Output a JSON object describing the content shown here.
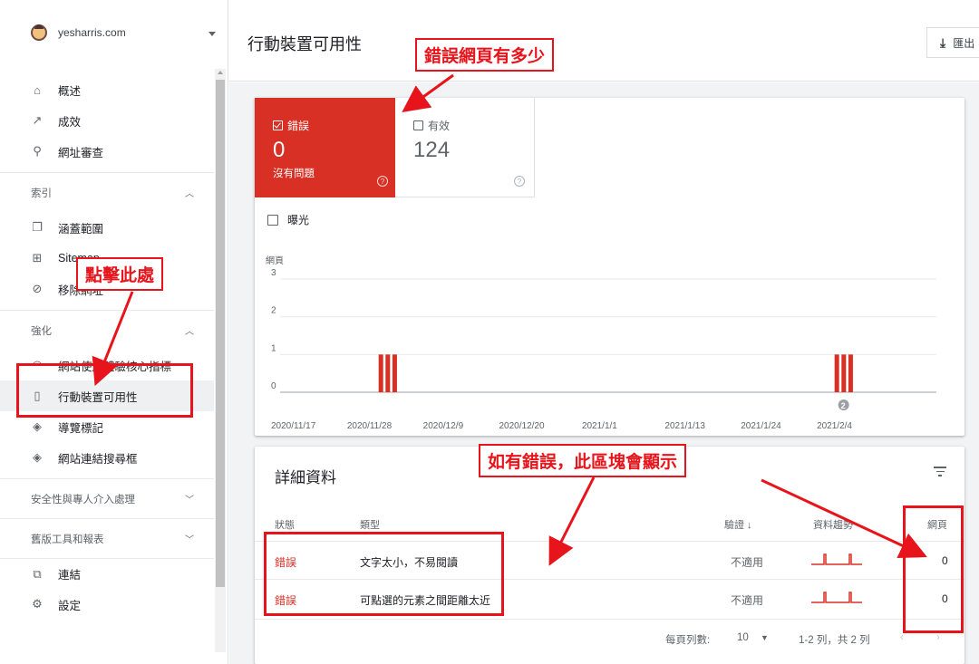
{
  "account": {
    "name": "yesharris.com"
  },
  "sidebar": {
    "top_items": [
      {
        "label": "概述",
        "icon": "home-icon"
      },
      {
        "label": "成效",
        "icon": "trending-icon"
      },
      {
        "label": "網址審查",
        "icon": "search-icon"
      }
    ],
    "index_section": {
      "title": "索引"
    },
    "index_items": [
      {
        "label": "涵蓋範圍",
        "icon": "copy-icon"
      },
      {
        "label": "Sitemap",
        "icon": "sitemap-icon"
      },
      {
        "label": "移除網址",
        "icon": "hidden-icon"
      }
    ],
    "enhance_section": {
      "title": "強化"
    },
    "enhance_items": [
      {
        "label": "網站使用體驗核心指標",
        "icon": "gauge-icon"
      },
      {
        "label": "行動裝置可用性",
        "icon": "phone-icon"
      },
      {
        "label": "導覽標記",
        "icon": "layers-icon"
      },
      {
        "label": "網站連結搜尋框",
        "icon": "layers-icon"
      }
    ],
    "security_section": {
      "title": "安全性與專人介入處理"
    },
    "legacy_section": {
      "title": "舊版工具和報表"
    },
    "bottom_items": [
      {
        "label": "連結",
        "icon": "links-icon"
      },
      {
        "label": "設定",
        "icon": "settings-icon"
      }
    ]
  },
  "header": {
    "title": "行動裝置可用性",
    "export_label": "匯出"
  },
  "summary": {
    "error": {
      "label": "錯誤",
      "value": "0",
      "sub": "沒有問題",
      "help": "?"
    },
    "valid": {
      "label": "有效",
      "value": "124",
      "help": "?"
    },
    "impressions_label": "曝光"
  },
  "chart_data": {
    "type": "bar",
    "ylabel": "網頁",
    "yticks": [
      "0",
      "1",
      "2",
      "3"
    ],
    "ylim": [
      0,
      3
    ],
    "xticks": [
      "2020/11/17",
      "2020/11/28",
      "2020/12/9",
      "2020/12/20",
      "2021/1/1",
      "2021/1/13",
      "2021/1/24",
      "2021/2/4"
    ],
    "series": [
      {
        "color": "#d93025",
        "points": [
          {
            "day": 14,
            "value": 1
          },
          {
            "day": 15,
            "value": 1
          },
          {
            "day": 16,
            "value": 1
          },
          {
            "day": 80,
            "value": 1
          },
          {
            "day": 81,
            "value": 1
          },
          {
            "day": 82,
            "value": 1
          }
        ]
      }
    ],
    "annotation": {
      "label": "2"
    },
    "grid": true
  },
  "details": {
    "title": "詳細資料",
    "columns": {
      "status": "狀態",
      "type": "類型",
      "validation": "驗證 ↓",
      "trend": "資料趨勢",
      "pages": "網頁"
    },
    "rows": [
      {
        "status": "錯誤",
        "type": "文字太小，不易閱讀",
        "validation": "不適用",
        "pages": "0"
      },
      {
        "status": "錯誤",
        "type": "可點選的元素之間距離太近",
        "validation": "不適用",
        "pages": "0"
      }
    ],
    "pager": {
      "rows_label": "每頁列數:",
      "rows_value": "10",
      "range": "1-2 列，共 2 列"
    }
  },
  "annotations": {
    "top": "錯誤網頁有多少",
    "left": "點擊此處",
    "middle": "如有錯誤，此區塊會顯示"
  },
  "colors": {
    "error": "#d93025",
    "annotation": "#e8141b"
  }
}
